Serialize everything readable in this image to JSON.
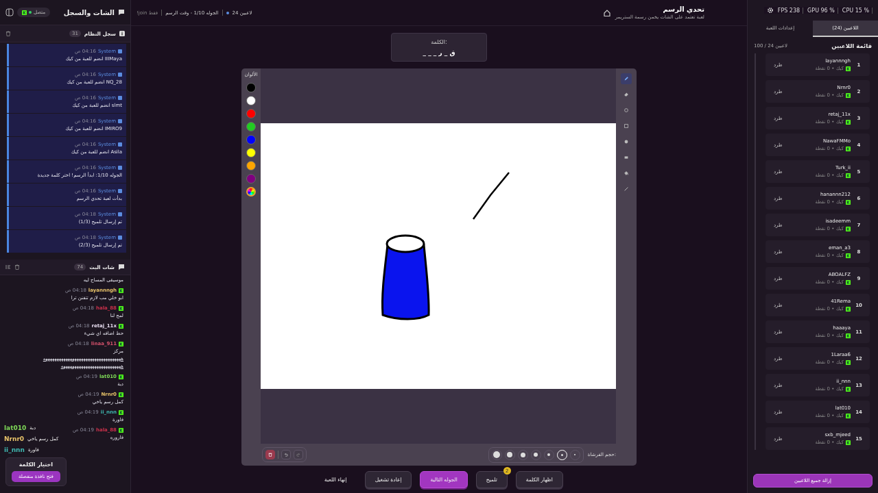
{
  "left_panel": {
    "title": "الشات والسجل",
    "status": "متصل",
    "connected": true,
    "system_log": {
      "title": "سجل النظام",
      "count": "31",
      "entries": [
        {
          "source": "System",
          "time": "04:16 ص",
          "text": "IIIMaya انضم للعبة من كيك"
        },
        {
          "source": "System",
          "time": "04:16 ص",
          "text": "NQ_28 انضم للعبة من كيك"
        },
        {
          "source": "System",
          "time": "04:16 ص",
          "text": "slmt انضم للعبة من كيك"
        },
        {
          "source": "System",
          "time": "04:16 ص",
          "text": "IMIRO9 انضم للعبة من كيك"
        },
        {
          "source": "System",
          "time": "04:16 ص",
          "text": "Asila انضم للعبة من كيك"
        },
        {
          "source": "System",
          "time": "04:16 ص",
          "text": "الجوله 1/10: ابدأ الرسم! اختر كلمة جديدة"
        },
        {
          "source": "System",
          "time": "04:16 ص",
          "text": "بدأت لعبة تحدي الرسم"
        },
        {
          "source": "System",
          "time": "04:18 ص",
          "text": "تم إرسال تلميح (1/3)"
        },
        {
          "source": "System",
          "time": "04:18 ص",
          "text": "تم إرسال تلميح (2/3)"
        }
      ]
    },
    "chat": {
      "title": "شات البث",
      "count": "74",
      "messages": [
        {
          "kind": "continued",
          "lines": [
            "موسيقى المساج ليه"
          ]
        },
        {
          "kind": "message",
          "user": "layannngh",
          "color": "#e8c46a",
          "time": "04:18 ص",
          "lines": [
            "ابو خلي مب لازم تتفنن ترا"
          ]
        },
        {
          "kind": "message",
          "user": "hala_88",
          "color": "#c8304a",
          "time": "04:18 ص",
          "lines": [
            "لمح لنا"
          ]
        },
        {
          "kind": "message",
          "user": "retaj_11x",
          "color": "#e6dcef",
          "time": "04:18 ص",
          "lines": [
            "حط اضافه اي شيء"
          ]
        },
        {
          "kind": "message",
          "user": "linaa_911",
          "color": "#d0506a",
          "time": "04:18 ص",
          "lines": [
            "مركز",
            "هههههههههههههههههههههههههههههههههههه",
            "هههههههههههههههههههههههههههه"
          ]
        },
        {
          "kind": "message",
          "user": "lat010",
          "color": "#7ed957",
          "time": "04:19 ص",
          "lines": [
            "دبة"
          ]
        },
        {
          "kind": "message",
          "user": "Nrnr0",
          "color": "#e8c46a",
          "time": "04:19 ص",
          "lines": [
            "كمل رسم ياخي"
          ]
        },
        {
          "kind": "message",
          "user": "ii_nnn",
          "color": "#3fb8b0",
          "time": "04:19 ص",
          "lines": [
            "فاورة"
          ]
        },
        {
          "kind": "message",
          "user": "hala_88",
          "color": "#c8304a",
          "time": "04:19 ص",
          "lines": [
            "فاروره"
          ]
        }
      ]
    },
    "overlay": {
      "lines": [
        {
          "user": "lat010",
          "color": "#7ed957",
          "text": "دبة"
        },
        {
          "user": "Nrnr0",
          "color": "#e8c46a",
          "text": "كمل رسم ياخي"
        },
        {
          "user": "ii_nnn",
          "color": "#3fb8b0",
          "text": "فاورة"
        }
      ],
      "popup": {
        "title": "اختيار الكلمة",
        "button": "فتح نافذة منفصلة"
      }
    }
  },
  "top_bar": {
    "players": "24 لاعبين",
    "round": "الجوله 1/10 - وقت الرسم",
    "mode": "!join فقط",
    "title": "تحدي الرسم",
    "subtitle": "لعبة تعتمد على الشات يخمن رسمة الستريمر"
  },
  "stats": [
    "CPU 15 %",
    "GPU 96 %",
    "FPS 238"
  ],
  "word": {
    "label": "الكلمة:",
    "hint": "ق _ ر _ _ _"
  },
  "canvas": {
    "palette_label": "الألوان",
    "colors": [
      {
        "color": "#000000",
        "kind": "swatch"
      },
      {
        "color": "#ffffff",
        "kind": "swatch"
      },
      {
        "color": "#ff0000",
        "kind": "swatch"
      },
      {
        "color": "#22cc22",
        "kind": "swatch"
      },
      {
        "color": "#0000ff",
        "kind": "swatch"
      },
      {
        "color": "#ffff00",
        "kind": "swatch"
      },
      {
        "color": "#ffa500",
        "kind": "swatch"
      },
      {
        "color": "#800080",
        "kind": "swatch"
      },
      {
        "kind": "custom"
      }
    ],
    "tools": [
      {
        "kind": "pencil",
        "selected": true
      },
      {
        "kind": "eraser",
        "selected": false
      },
      {
        "kind": "circle",
        "selected": false
      },
      {
        "kind": "rect",
        "selected": false
      },
      {
        "kind": "filled-circle",
        "selected": false
      },
      {
        "kind": "filled-rect",
        "selected": false
      },
      {
        "kind": "fill",
        "selected": false
      },
      {
        "kind": "line",
        "selected": false
      }
    ],
    "brush_label": "حجم الفرشاة:",
    "brush_sizes": [
      {
        "selected": false
      },
      {
        "selected": true
      },
      {
        "selected": false
      },
      {
        "selected": false
      },
      {
        "selected": false
      },
      {
        "selected": false
      },
      {
        "selected": false
      }
    ]
  },
  "actions": [
    {
      "label": "اظهار الكلمة",
      "kind": "secondary"
    },
    {
      "label": "تلميح",
      "kind": "secondary",
      "badge": "2"
    },
    {
      "label": "الجوله التالية",
      "kind": "primary"
    },
    {
      "label": "إعادة تشغيل",
      "kind": "secondary"
    },
    {
      "label": "إنهاء اللعبة",
      "kind": "plain"
    }
  ],
  "right_panel": {
    "tabs": [
      {
        "label": "اللاعبين (24)",
        "selected": true
      },
      {
        "label": "إعدادات اللعبة",
        "selected": false
      }
    ],
    "title": "قائمة اللاعبين",
    "count": "100 / 24 لاعبين",
    "players": [
      {
        "rank": "1",
        "name": "layannngh",
        "info": "كيك • 0 نقطة",
        "action": "طرد"
      },
      {
        "rank": "2",
        "name": "Nrnr0",
        "info": "كيك • 0 نقطة",
        "action": "طرد"
      },
      {
        "rank": "3",
        "name": "retaj_11x",
        "info": "كيك • 0 نقطة",
        "action": "طرد"
      },
      {
        "rank": "4",
        "name": "NawaFMMo",
        "info": "كيك • 0 نقطة",
        "action": "طرد"
      },
      {
        "rank": "5",
        "name": "Turk_ii",
        "info": "كيك • 0 نقطة",
        "action": "طرد"
      },
      {
        "rank": "6",
        "name": "hanannn212",
        "info": "كيك • 0 نقطة",
        "action": "طرد"
      },
      {
        "rank": "7",
        "name": "isadeemm",
        "info": "كيك • 0 نقطة",
        "action": "طرد"
      },
      {
        "rank": "8",
        "name": "eman_a3",
        "info": "كيك • 0 نقطة",
        "action": "طرد"
      },
      {
        "rank": "9",
        "name": "ABOALFZ",
        "info": "كيك • 0 نقطة",
        "action": "طرد"
      },
      {
        "rank": "10",
        "name": "41Rema",
        "info": "كيك • 0 نقطة",
        "action": "طرد"
      },
      {
        "rank": "11",
        "name": "haaaya",
        "info": "كيك • 0 نقطة",
        "action": "طرد"
      },
      {
        "rank": "12",
        "name": "1Laraa6",
        "info": "كيك • 0 نقطة",
        "action": "طرد"
      },
      {
        "rank": "13",
        "name": "ii_nnn",
        "info": "كيك • 0 نقطة",
        "action": "طرد"
      },
      {
        "rank": "14",
        "name": "lat010",
        "info": "كيك • 0 نقطة",
        "action": "طرد"
      },
      {
        "rank": "15",
        "name": "sxb_mjeed",
        "info": "كيك • 0 نقطة",
        "action": "طرد"
      }
    ],
    "remove_all": "إزالة جميع اللاعبين"
  }
}
